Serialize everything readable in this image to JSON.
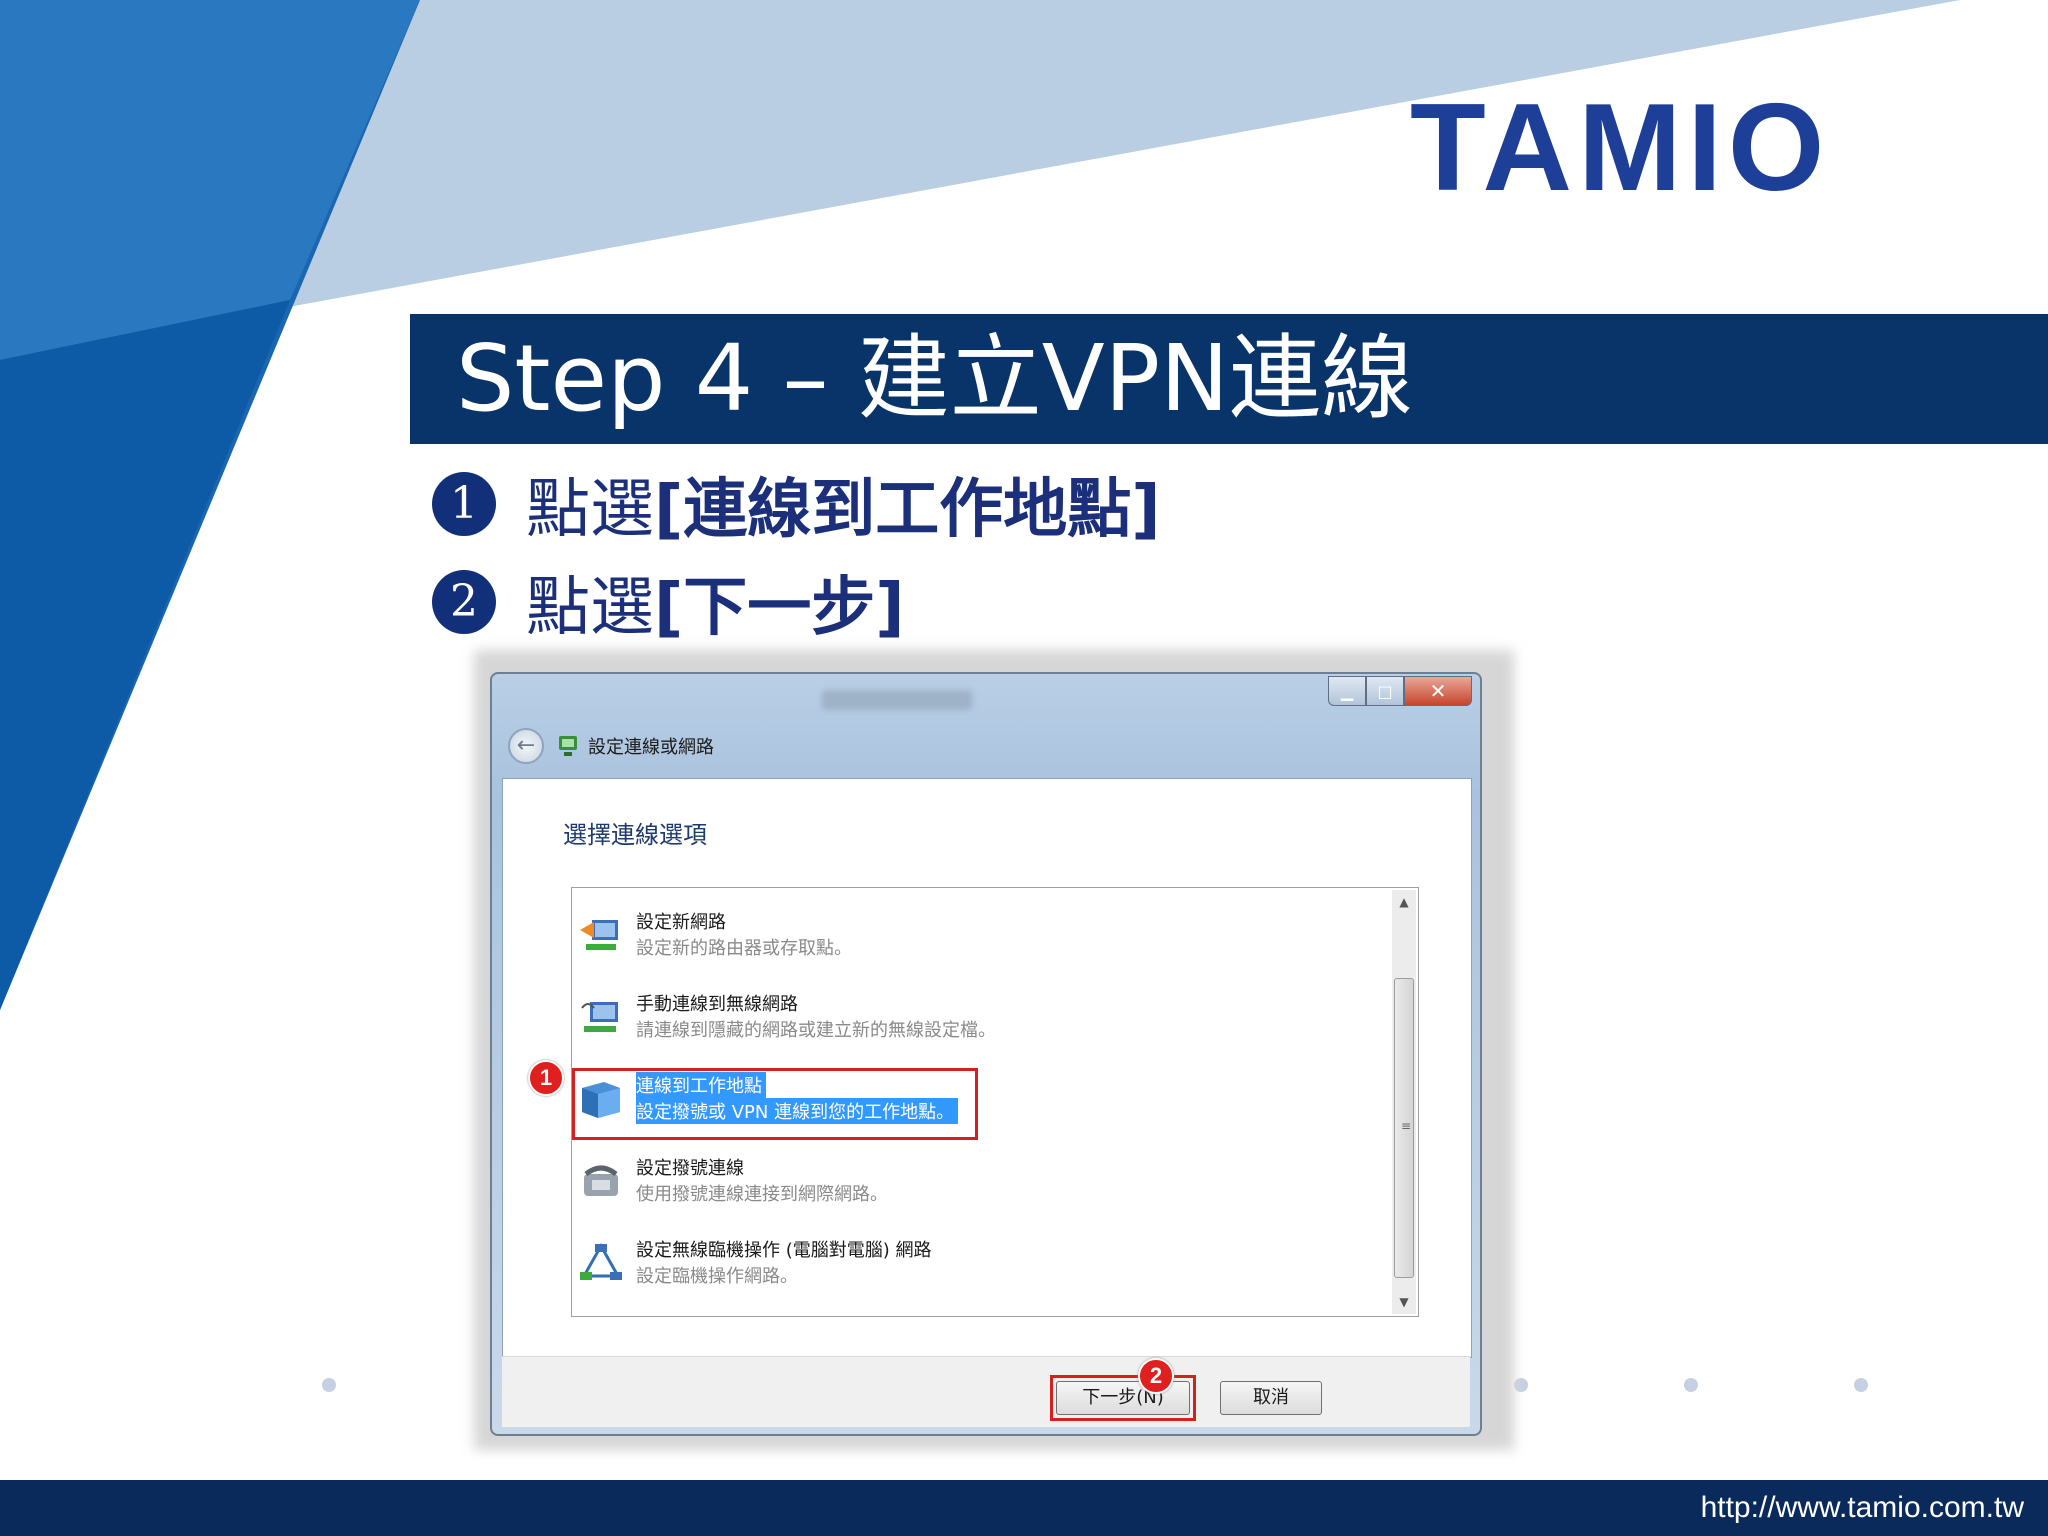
{
  "brand": {
    "logo_text": "TAMIO",
    "color": "#1e3f98"
  },
  "title": "Step 4 – 建立VPN連線",
  "steps": [
    {
      "num": "1",
      "prefix": "點選",
      "bold": "[連線到工作地點]"
    },
    {
      "num": "2",
      "prefix": "點選",
      "bold": "[下一步]"
    }
  ],
  "dialog": {
    "nav_label": "設定連線或網路",
    "heading": "選擇連線選項",
    "options": [
      {
        "title": "設定新網路",
        "desc": "設定新的路由器或存取點。",
        "icon": "network-wizard-icon",
        "selected": false
      },
      {
        "title": "手動連線到無線網路",
        "desc": "請連線到隱藏的網路或建立新的無線設定檔。",
        "icon": "wireless-icon",
        "selected": false
      },
      {
        "title": "連線到工作地點",
        "desc": "設定撥號或 VPN 連線到您的工作地點。",
        "icon": "workplace-icon",
        "selected": true
      },
      {
        "title": "設定撥號連線",
        "desc": "使用撥號連線連接到網際網路。",
        "icon": "dialup-phone-icon",
        "selected": false
      },
      {
        "title": "設定無線臨機操作 (電腦對電腦) 網路",
        "desc": "設定臨機操作網路。",
        "icon": "adhoc-network-icon",
        "selected": false
      }
    ],
    "next_button": "下一步(N)",
    "cancel_button": "取消",
    "badges": [
      "1",
      "2"
    ]
  },
  "footer": {
    "url": "http://www.tamio.com.tw"
  },
  "colors": {
    "title_bar": "#08346a",
    "bottom_bar": "#0a2a5c",
    "step_text": "#1b2f7a",
    "selection": "#3399ff",
    "highlight": "#d42020"
  }
}
